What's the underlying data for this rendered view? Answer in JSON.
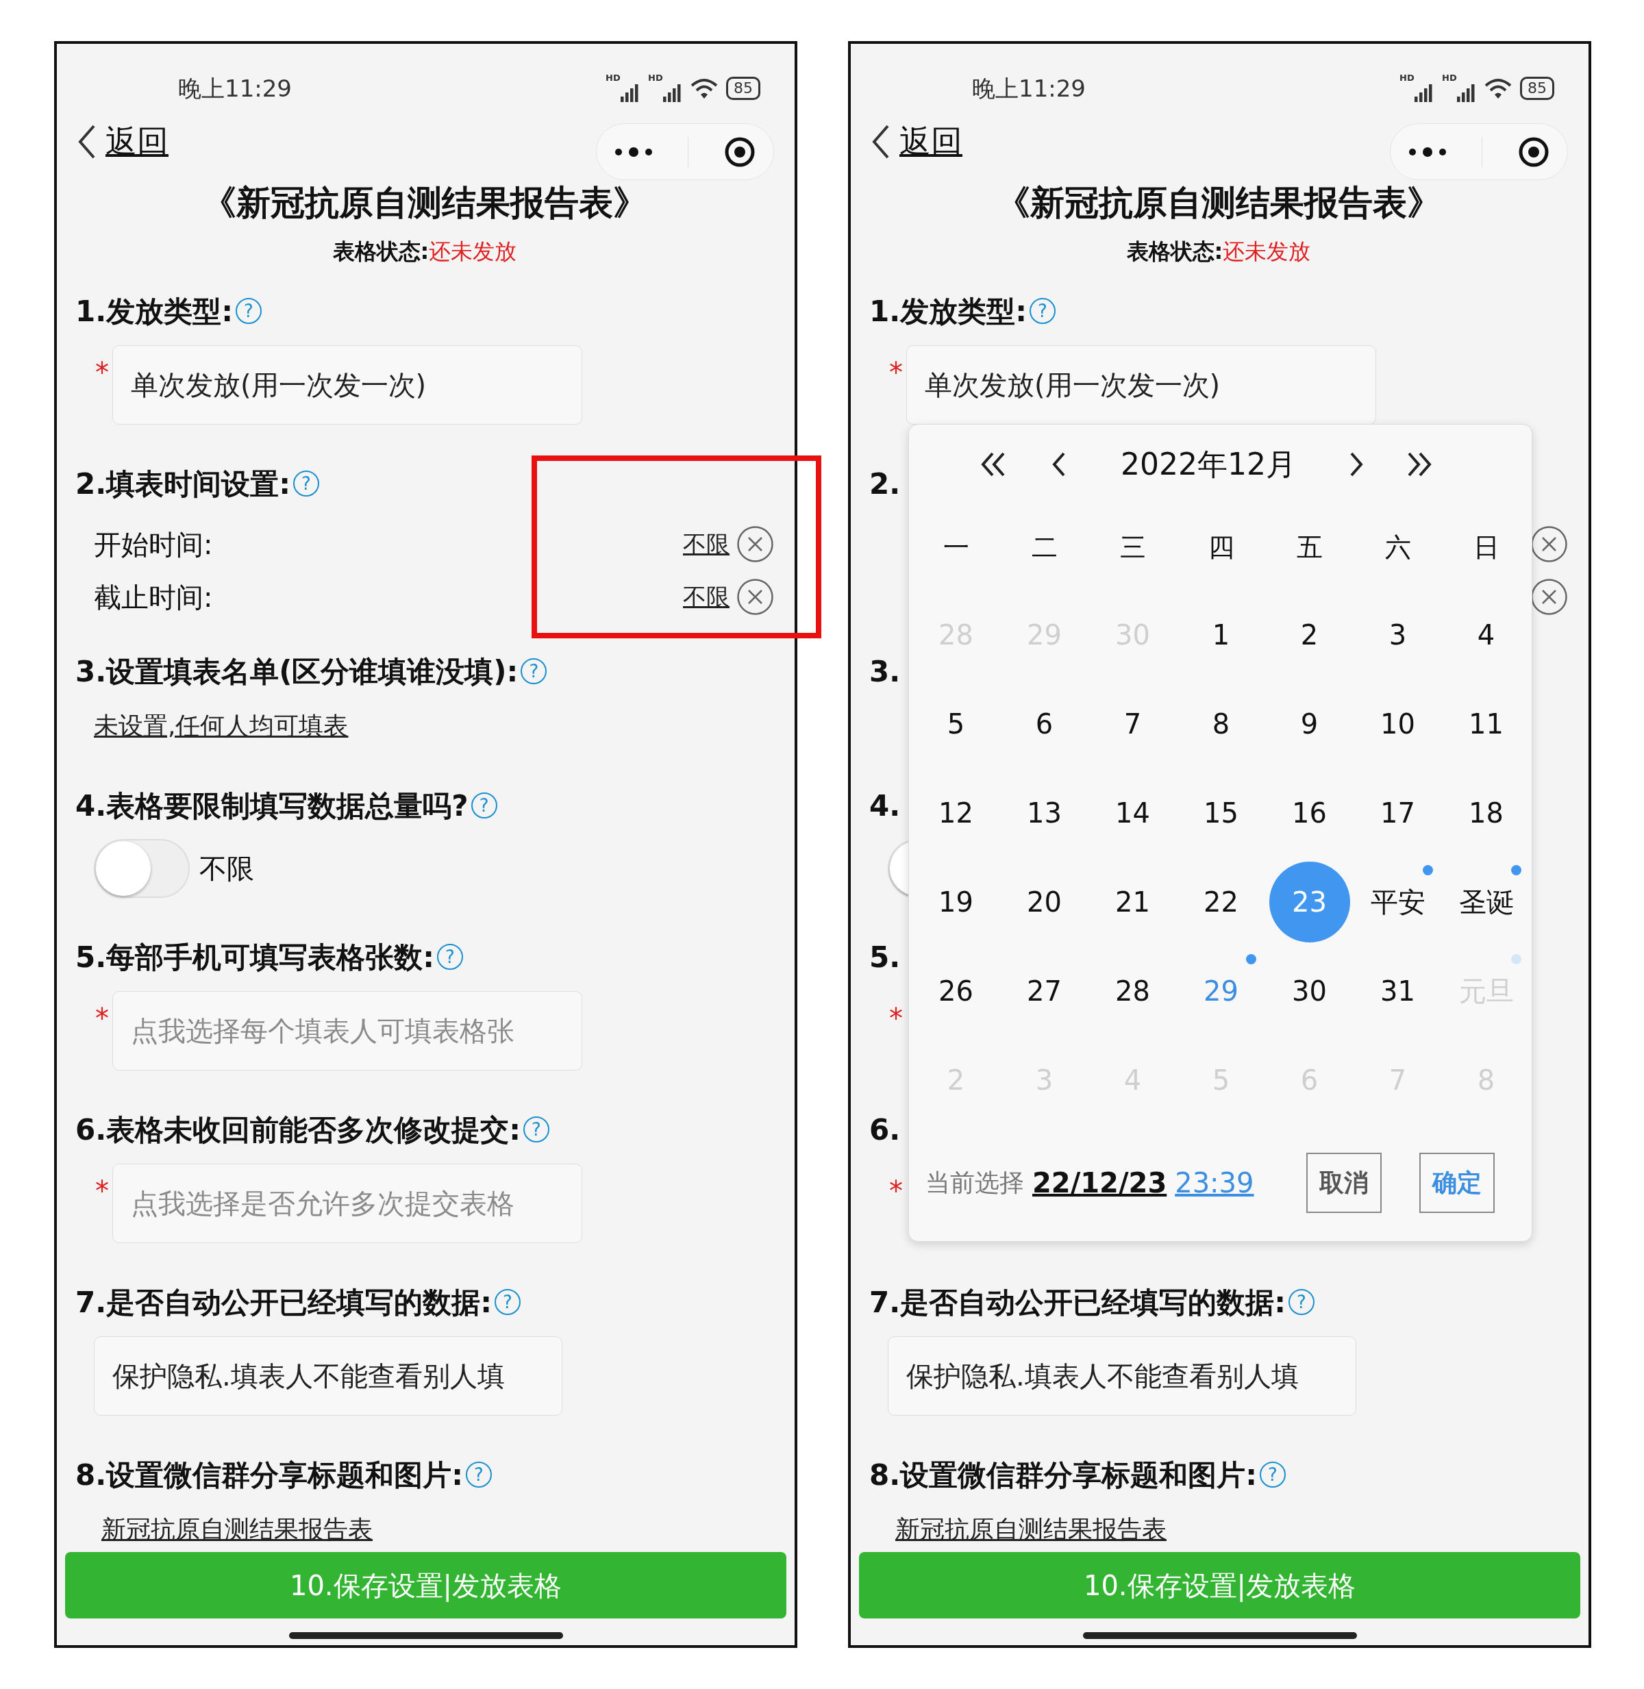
{
  "phones": [
    {
      "status_bar": {
        "time": "晚上11:29",
        "signal_labels": [
          "HD",
          "HD"
        ],
        "battery": "85"
      },
      "nav": {
        "back": "返回"
      },
      "title": "《新冠抗原自测结果报告表》",
      "form_status": {
        "label": "表格状态:",
        "value": "还未发放"
      },
      "sections": [
        {
          "kind": "select",
          "title": "1.发放类型:",
          "help": "?",
          "mark": "*",
          "value": "单次发放(用一次发一次)"
        },
        {
          "kind": "times",
          "title": "2.填表时间设置:",
          "help": "?",
          "highlighted": true,
          "rows": [
            {
              "label": "开始时间:",
              "value": "不限",
              "clear": true
            },
            {
              "label": "截止时间:",
              "value": "不限",
              "clear": true
            }
          ]
        },
        {
          "kind": "link",
          "title": "3.设置填表名单(区分谁填谁没填):",
          "help": "?",
          "link": "未设置,任何人均可填表"
        },
        {
          "kind": "toggle",
          "title": "4.表格要限制填写数据总量吗?",
          "help": "?",
          "toggle": {
            "on": false,
            "label": "不限"
          }
        },
        {
          "kind": "select",
          "title": "5.每部手机可填写表格张数:",
          "help": "?",
          "mark": "*",
          "placeholder": "点我选择每个填表人可填表格张"
        },
        {
          "kind": "select",
          "title": "6.表格未收回前能否多次修改提交:",
          "help": "?",
          "mark": "*",
          "placeholder": "点我选择是否允许多次提交表格"
        },
        {
          "kind": "input",
          "title": "7.是否自动公开已经填写的数据:",
          "help": "?",
          "value": "保护隐私.填表人不能查看别人填"
        },
        {
          "kind": "share",
          "title": "8.设置微信群分享标题和图片:",
          "help": "?",
          "link": "新冠抗原自测结果报告表"
        }
      ],
      "save_button": "10.保存设置|发放表格"
    },
    {
      "status_bar": {
        "time": "晚上11:29",
        "signal_labels": [
          "HD",
          "HD"
        ],
        "battery": "85"
      },
      "nav": {
        "back": "返回"
      },
      "title": "《新冠抗原自测结果报告表》",
      "form_status": {
        "label": "表格状态:",
        "value": "还未发放"
      },
      "sections": [
        {
          "kind": "select",
          "title": "1.发放类型:",
          "help": "?",
          "mark": "*",
          "value": "单次发放(用一次发一次)"
        },
        {
          "kind": "times",
          "title": "2.",
          "rows": [
            {
              "clear": true
            },
            {
              "clear": true
            }
          ]
        },
        {
          "kind": "link",
          "title": "3."
        },
        {
          "kind": "toggle",
          "title": "4.",
          "toggle": {
            "on": false
          }
        },
        {
          "kind": "select",
          "title": "5.",
          "mark": "*"
        },
        {
          "kind": "select",
          "title": "6.",
          "mark": "*"
        },
        {
          "kind": "input",
          "title": "7.是否自动公开已经填写的数据:",
          "help": "?",
          "value": "保护隐私.填表人不能查看别人填"
        },
        {
          "kind": "share",
          "title": "8.设置微信群分享标题和图片:",
          "help": "?",
          "link": "新冠抗原自测结果报告表"
        }
      ],
      "save_button": "10.保存设置|发放表格",
      "calendar": {
        "month": "2022年12月",
        "weekdays": [
          "一",
          "二",
          "三",
          "四",
          "五",
          "六",
          "日"
        ],
        "days": [
          {
            "label": "28",
            "selected": false,
            "other_month": true,
            "marked": false,
            "accent": false
          },
          {
            "label": "29",
            "selected": false,
            "other_month": true,
            "marked": false,
            "accent": false
          },
          {
            "label": "30",
            "selected": false,
            "other_month": true,
            "marked": false,
            "accent": false
          },
          {
            "label": "1",
            "selected": false,
            "other_month": false,
            "marked": false,
            "accent": false
          },
          {
            "label": "2",
            "selected": false,
            "other_month": false,
            "marked": false,
            "accent": false
          },
          {
            "label": "3",
            "selected": false,
            "other_month": false,
            "marked": false,
            "accent": false
          },
          {
            "label": "4",
            "selected": false,
            "other_month": false,
            "marked": false,
            "accent": false
          },
          {
            "label": "5",
            "selected": false,
            "other_month": false,
            "marked": false,
            "accent": false
          },
          {
            "label": "6",
            "selected": false,
            "other_month": false,
            "marked": false,
            "accent": false
          },
          {
            "label": "7",
            "selected": false,
            "other_month": false,
            "marked": false,
            "accent": false
          },
          {
            "label": "8",
            "selected": false,
            "other_month": false,
            "marked": false,
            "accent": false
          },
          {
            "label": "9",
            "selected": false,
            "other_month": false,
            "marked": false,
            "accent": false
          },
          {
            "label": "10",
            "selected": false,
            "other_month": false,
            "marked": false,
            "accent": false
          },
          {
            "label": "11",
            "selected": false,
            "other_month": false,
            "marked": false,
            "accent": false
          },
          {
            "label": "12",
            "selected": false,
            "other_month": false,
            "marked": false,
            "accent": false
          },
          {
            "label": "13",
            "selected": false,
            "other_month": false,
            "marked": false,
            "accent": false
          },
          {
            "label": "14",
            "selected": false,
            "other_month": false,
            "marked": false,
            "accent": false
          },
          {
            "label": "15",
            "selected": false,
            "other_month": false,
            "marked": false,
            "accent": false
          },
          {
            "label": "16",
            "selected": false,
            "other_month": false,
            "marked": false,
            "accent": false
          },
          {
            "label": "17",
            "selected": false,
            "other_month": false,
            "marked": false,
            "accent": false
          },
          {
            "label": "18",
            "selected": false,
            "other_month": false,
            "marked": false,
            "accent": false
          },
          {
            "label": "19",
            "selected": false,
            "other_month": false,
            "marked": false,
            "accent": false
          },
          {
            "label": "20",
            "selected": false,
            "other_month": false,
            "marked": false,
            "accent": false
          },
          {
            "label": "21",
            "selected": false,
            "other_month": false,
            "marked": false,
            "accent": false
          },
          {
            "label": "22",
            "selected": false,
            "other_month": false,
            "marked": false,
            "accent": false
          },
          {
            "label": "23",
            "selected": true,
            "other_month": false,
            "marked": false,
            "accent": false
          },
          {
            "label": "平安",
            "selected": false,
            "other_month": false,
            "marked": true,
            "accent": false
          },
          {
            "label": "圣诞",
            "selected": false,
            "other_month": false,
            "marked": true,
            "accent": false
          },
          {
            "label": "26",
            "selected": false,
            "other_month": false,
            "marked": false,
            "accent": false
          },
          {
            "label": "27",
            "selected": false,
            "other_month": false,
            "marked": false,
            "accent": false
          },
          {
            "label": "28",
            "selected": false,
            "other_month": false,
            "marked": false,
            "accent": false
          },
          {
            "label": "29",
            "selected": false,
            "other_month": false,
            "marked": true,
            "accent": true
          },
          {
            "label": "30",
            "selected": false,
            "other_month": false,
            "marked": false,
            "accent": false
          },
          {
            "label": "31",
            "selected": false,
            "other_month": false,
            "marked": false,
            "accent": false
          },
          {
            "label": "元旦",
            "selected": false,
            "other_month": true,
            "marked": true,
            "accent": false
          },
          {
            "label": "2",
            "selected": false,
            "other_month": true,
            "marked": false,
            "accent": false
          },
          {
            "label": "3",
            "selected": false,
            "other_month": true,
            "marked": false,
            "accent": false
          },
          {
            "label": "4",
            "selected": false,
            "other_month": true,
            "marked": false,
            "accent": false
          },
          {
            "label": "5",
            "selected": false,
            "other_month": true,
            "marked": false,
            "accent": false
          },
          {
            "label": "6",
            "selected": false,
            "other_month": true,
            "marked": false,
            "accent": false
          },
          {
            "label": "7",
            "selected": false,
            "other_month": true,
            "marked": false,
            "accent": false
          },
          {
            "label": "8",
            "selected": false,
            "other_month": true,
            "marked": false,
            "accent": false
          }
        ],
        "current_label": "当前选择",
        "current_date": "22/12/23",
        "current_time": "23:39",
        "buttons": [
          {
            "label": "取消",
            "kind": "cancel"
          },
          {
            "label": "确定",
            "kind": "confirm"
          }
        ]
      }
    }
  ]
}
